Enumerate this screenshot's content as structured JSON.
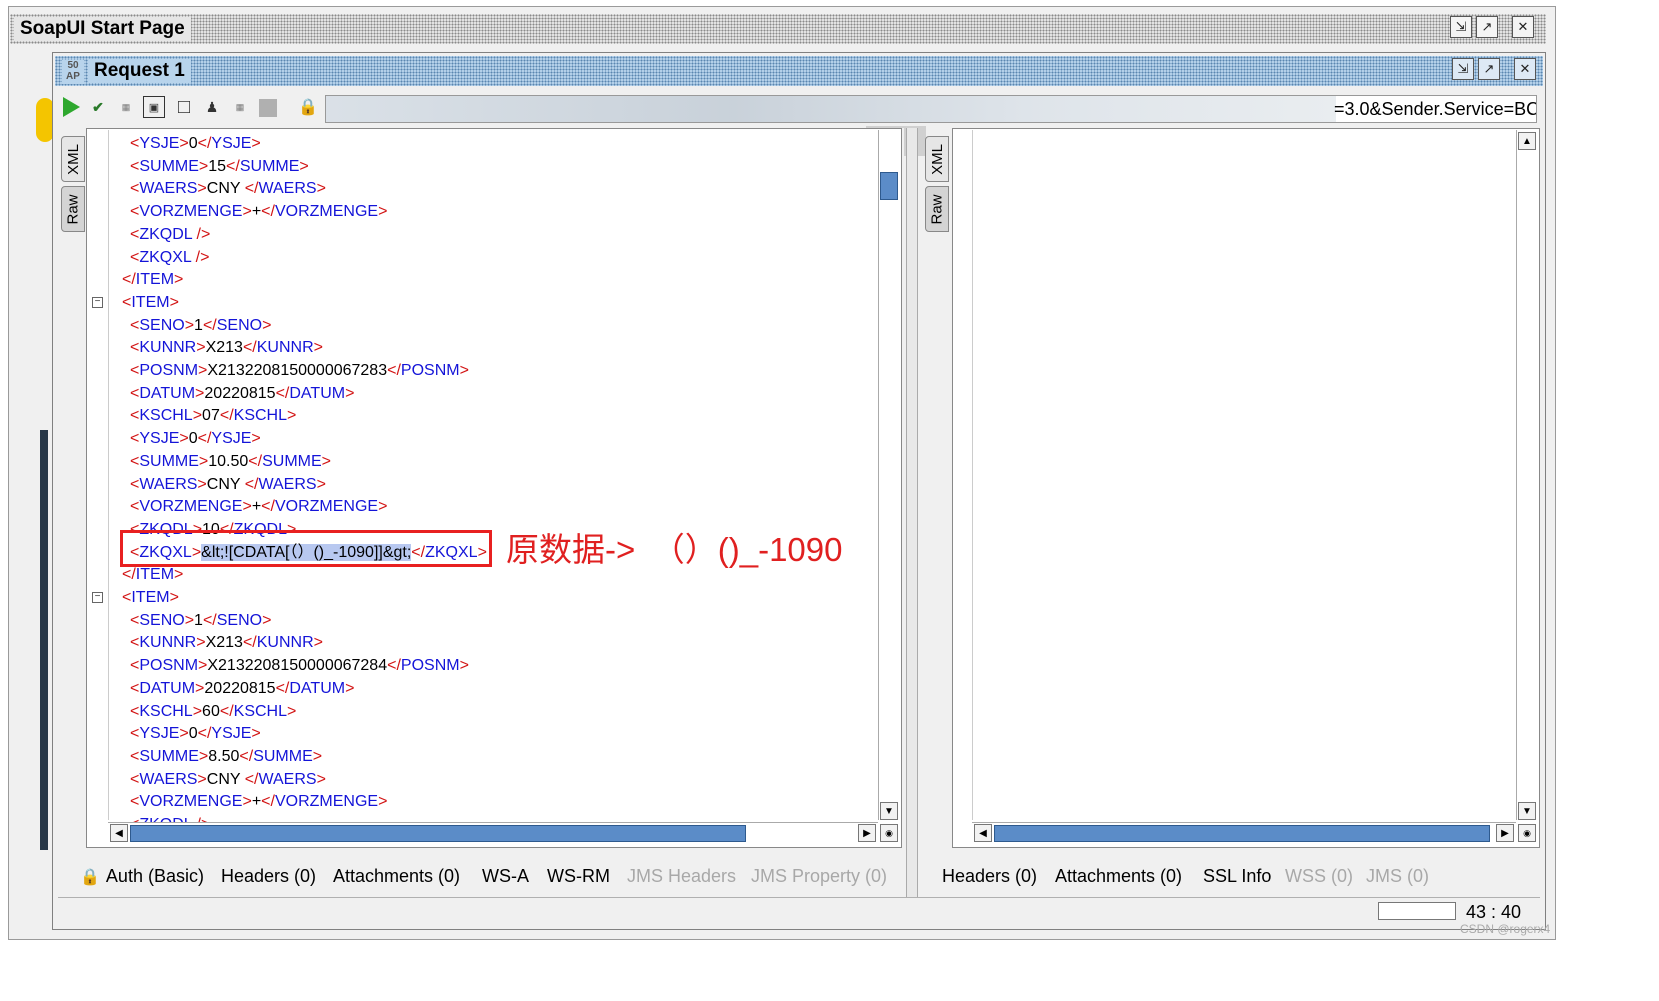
{
  "outer_window": {
    "title": "SoapUI Start Page"
  },
  "request_window": {
    "title": "Request 1",
    "logo": "50\nAP"
  },
  "toolbar": {
    "icons": [
      "play-icon",
      "submit-check-icon",
      "wsdl-icon",
      "format-icon",
      "stop-icon",
      "user-icon",
      "wsdl-2-icon",
      "blank-icon",
      "lock-icon"
    ],
    "endpoint_visible_text": "=3.0&Sender.Service=BC"
  },
  "left_editor": {
    "tabs": {
      "xml": "XML",
      "raw": "Raw"
    },
    "lines": [
      {
        "k": "el",
        "tag": "YSJE",
        "val": "0"
      },
      {
        "k": "el",
        "tag": "SUMME",
        "val": "15"
      },
      {
        "k": "el",
        "tag": "WAERS",
        "val": "CNY "
      },
      {
        "k": "el",
        "tag": "VORZMENGE",
        "val": "+"
      },
      {
        "k": "empty",
        "tag": "ZKQDL"
      },
      {
        "k": "empty",
        "tag": "ZKQXL"
      },
      {
        "k": "close",
        "tag": "ITEM"
      },
      {
        "k": "open",
        "tag": "ITEM",
        "fold": true
      },
      {
        "k": "el",
        "tag": "SENO",
        "val": "1"
      },
      {
        "k": "el",
        "tag": "KUNNR",
        "val": "X213"
      },
      {
        "k": "el",
        "tag": "POSNM",
        "val": "X2132208150000067283"
      },
      {
        "k": "el",
        "tag": "DATUM",
        "val": "20220815"
      },
      {
        "k": "el",
        "tag": "KSCHL",
        "val": "07"
      },
      {
        "k": "el",
        "tag": "YSJE",
        "val": "0"
      },
      {
        "k": "el",
        "tag": "SUMME",
        "val": "10.50"
      },
      {
        "k": "el",
        "tag": "WAERS",
        "val": "CNY "
      },
      {
        "k": "el",
        "tag": "VORZMENGE",
        "val": "+"
      },
      {
        "k": "el",
        "tag": "ZKQDL",
        "val": "10"
      },
      {
        "k": "hl",
        "tag": "ZKQXL",
        "val": "&lt;![CDATA[（）()_-1090]]&gt;"
      },
      {
        "k": "close",
        "tag": "ITEM"
      },
      {
        "k": "open",
        "tag": "ITEM",
        "fold": true
      },
      {
        "k": "el",
        "tag": "SENO",
        "val": "1"
      },
      {
        "k": "el",
        "tag": "KUNNR",
        "val": "X213"
      },
      {
        "k": "el",
        "tag": "POSNM",
        "val": "X2132208150000067284"
      },
      {
        "k": "el",
        "tag": "DATUM",
        "val": "20220815"
      },
      {
        "k": "el",
        "tag": "KSCHL",
        "val": "60"
      },
      {
        "k": "el",
        "tag": "YSJE",
        "val": "0"
      },
      {
        "k": "el",
        "tag": "SUMME",
        "val": "8.50"
      },
      {
        "k": "el",
        "tag": "WAERS",
        "val": "CNY "
      },
      {
        "k": "el",
        "tag": "VORZMENGE",
        "val": "+"
      },
      {
        "k": "empty",
        "tag": "ZKQDL"
      }
    ],
    "annotation": "原数据->　（）()_-1090"
  },
  "right_editor": {
    "tabs": {
      "xml": "XML",
      "raw": "Raw"
    }
  },
  "left_bottom_tabs": [
    {
      "label": "Auth (Basic)",
      "enabled": true,
      "icon": "lock-icon"
    },
    {
      "label": "Headers (0)",
      "enabled": true
    },
    {
      "label": "Attachments (0)",
      "enabled": true
    },
    {
      "label": "WS-A",
      "enabled": true
    },
    {
      "label": "WS-RM",
      "enabled": true
    },
    {
      "label": "JMS Headers",
      "enabled": false
    },
    {
      "label": "JMS Property (0)",
      "enabled": false
    }
  ],
  "right_bottom_tabs": [
    {
      "label": "Headers (0)",
      "enabled": true
    },
    {
      "label": "Attachments (0)",
      "enabled": true
    },
    {
      "label": "SSL Info",
      "enabled": true
    },
    {
      "label": "WSS (0)",
      "enabled": false
    },
    {
      "label": "JMS (0)",
      "enabled": false
    }
  ],
  "status": {
    "cursor_position": "43 : 40"
  },
  "watermark": "CSDN @rogerx4",
  "colors": {
    "tag": "#1414d8",
    "bracket": "#d21414",
    "annotation": "#e02020",
    "selection": "#b8c8f0",
    "scroll_thumb": "#5b8cc8"
  }
}
